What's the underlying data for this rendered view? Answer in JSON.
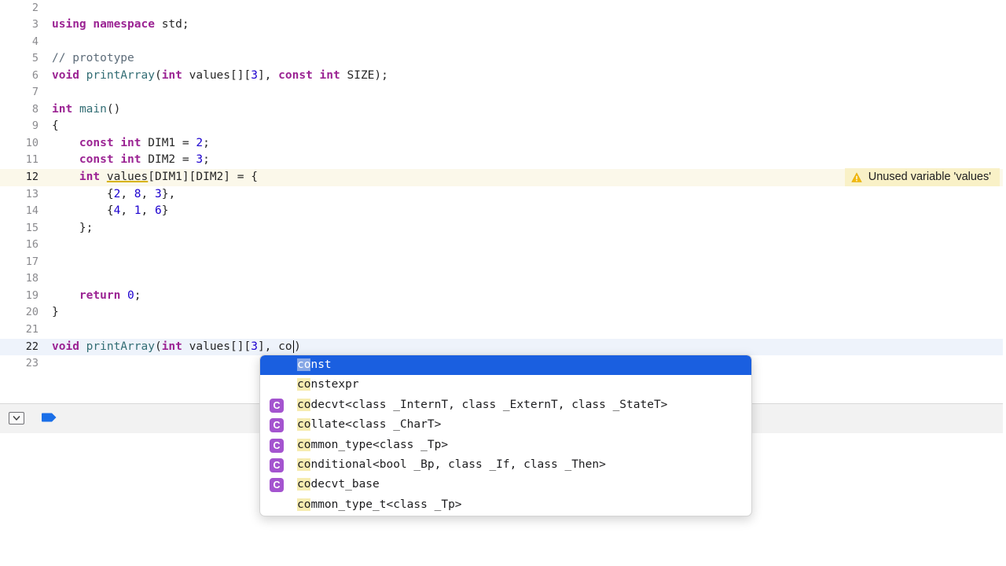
{
  "editor": {
    "lines": [
      {
        "num": "2",
        "tokens": []
      },
      {
        "num": "3",
        "tokens": [
          {
            "t": "using",
            "c": "kw"
          },
          {
            "t": " ",
            "c": "plain"
          },
          {
            "t": "namespace",
            "c": "kw"
          },
          {
            "t": " std;",
            "c": "plain"
          }
        ]
      },
      {
        "num": "4",
        "tokens": []
      },
      {
        "num": "5",
        "tokens": [
          {
            "t": "// prototype",
            "c": "cmt"
          }
        ]
      },
      {
        "num": "6",
        "tokens": [
          {
            "t": "void",
            "c": "kw"
          },
          {
            "t": " ",
            "c": "plain"
          },
          {
            "t": "printArray",
            "c": "fn"
          },
          {
            "t": "(",
            "c": "plain"
          },
          {
            "t": "int",
            "c": "kw"
          },
          {
            "t": " values[][",
            "c": "plain"
          },
          {
            "t": "3",
            "c": "num"
          },
          {
            "t": "], ",
            "c": "plain"
          },
          {
            "t": "const",
            "c": "kw"
          },
          {
            "t": " ",
            "c": "plain"
          },
          {
            "t": "int",
            "c": "kw"
          },
          {
            "t": " SIZE);",
            "c": "plain"
          }
        ]
      },
      {
        "num": "7",
        "tokens": []
      },
      {
        "num": "8",
        "tokens": [
          {
            "t": "int",
            "c": "kw"
          },
          {
            "t": " ",
            "c": "plain"
          },
          {
            "t": "main",
            "c": "fn"
          },
          {
            "t": "()",
            "c": "plain"
          }
        ]
      },
      {
        "num": "9",
        "tokens": [
          {
            "t": "{",
            "c": "plain"
          }
        ]
      },
      {
        "num": "10",
        "tokens": [
          {
            "t": "    ",
            "c": "plain"
          },
          {
            "t": "const",
            "c": "kw"
          },
          {
            "t": " ",
            "c": "plain"
          },
          {
            "t": "int",
            "c": "kw"
          },
          {
            "t": " DIM1 = ",
            "c": "plain"
          },
          {
            "t": "2",
            "c": "num"
          },
          {
            "t": ";",
            "c": "plain"
          }
        ]
      },
      {
        "num": "11",
        "tokens": [
          {
            "t": "    ",
            "c": "plain"
          },
          {
            "t": "const",
            "c": "kw"
          },
          {
            "t": " ",
            "c": "plain"
          },
          {
            "t": "int",
            "c": "kw"
          },
          {
            "t": " DIM2 = ",
            "c": "plain"
          },
          {
            "t": "3",
            "c": "num"
          },
          {
            "t": ";",
            "c": "plain"
          }
        ]
      },
      {
        "num": "12",
        "highlight": true,
        "tokens": [
          {
            "t": "    ",
            "c": "plain"
          },
          {
            "t": "int",
            "c": "kw"
          },
          {
            "t": " ",
            "c": "plain"
          },
          {
            "t": "values",
            "c": "plain underline"
          },
          {
            "t": "[DIM1][DIM2] = {",
            "c": "plain"
          }
        ]
      },
      {
        "num": "13",
        "tokens": [
          {
            "t": "        {",
            "c": "plain"
          },
          {
            "t": "2",
            "c": "num"
          },
          {
            "t": ", ",
            "c": "plain"
          },
          {
            "t": "8",
            "c": "num"
          },
          {
            "t": ", ",
            "c": "plain"
          },
          {
            "t": "3",
            "c": "num"
          },
          {
            "t": "},",
            "c": "plain"
          }
        ]
      },
      {
        "num": "14",
        "tokens": [
          {
            "t": "        {",
            "c": "plain"
          },
          {
            "t": "4",
            "c": "num"
          },
          {
            "t": ", ",
            "c": "plain"
          },
          {
            "t": "1",
            "c": "num"
          },
          {
            "t": ", ",
            "c": "plain"
          },
          {
            "t": "6",
            "c": "num"
          },
          {
            "t": "}",
            "c": "plain"
          }
        ]
      },
      {
        "num": "15",
        "tokens": [
          {
            "t": "    };",
            "c": "plain"
          }
        ]
      },
      {
        "num": "16",
        "tokens": []
      },
      {
        "num": "17",
        "tokens": []
      },
      {
        "num": "18",
        "tokens": []
      },
      {
        "num": "19",
        "tokens": [
          {
            "t": "    ",
            "c": "plain"
          },
          {
            "t": "return",
            "c": "kw"
          },
          {
            "t": " ",
            "c": "plain"
          },
          {
            "t": "0",
            "c": "num"
          },
          {
            "t": ";",
            "c": "plain"
          }
        ]
      },
      {
        "num": "20",
        "tokens": [
          {
            "t": "}",
            "c": "plain"
          }
        ]
      },
      {
        "num": "21",
        "tokens": []
      },
      {
        "num": "22",
        "current": true,
        "tokens": [
          {
            "t": "void",
            "c": "kw"
          },
          {
            "t": " ",
            "c": "plain"
          },
          {
            "t": "printArray",
            "c": "fn"
          },
          {
            "t": "(",
            "c": "plain"
          },
          {
            "t": "int",
            "c": "kw"
          },
          {
            "t": " values[][",
            "c": "plain"
          },
          {
            "t": "3",
            "c": "num"
          },
          {
            "t": "], co)",
            "c": "plain"
          }
        ]
      },
      {
        "num": "23",
        "tokens": []
      }
    ],
    "warning": {
      "text": "Unused variable 'values'",
      "icon": "warning-triangle-icon",
      "color": "#f9f1c7"
    }
  },
  "autocomplete": {
    "typed_prefix": "co",
    "items": [
      {
        "label": "const",
        "badge": "",
        "selected": true
      },
      {
        "label": "constexpr",
        "badge": ""
      },
      {
        "label": "codecvt<class _InternT, class _ExternT, class _StateT>",
        "badge": "C"
      },
      {
        "label": "collate<class _CharT>",
        "badge": "C"
      },
      {
        "label": "common_type<class _Tp>",
        "badge": "C"
      },
      {
        "label": "conditional<bool _Bp, class _If, class _Then>",
        "badge": "C"
      },
      {
        "label": "codecvt_base",
        "badge": "C"
      },
      {
        "label": "common_type_t<class _Tp>",
        "badge": ""
      }
    ],
    "selected_color": "#1a5fe0",
    "badge_color": "#a454cf"
  }
}
